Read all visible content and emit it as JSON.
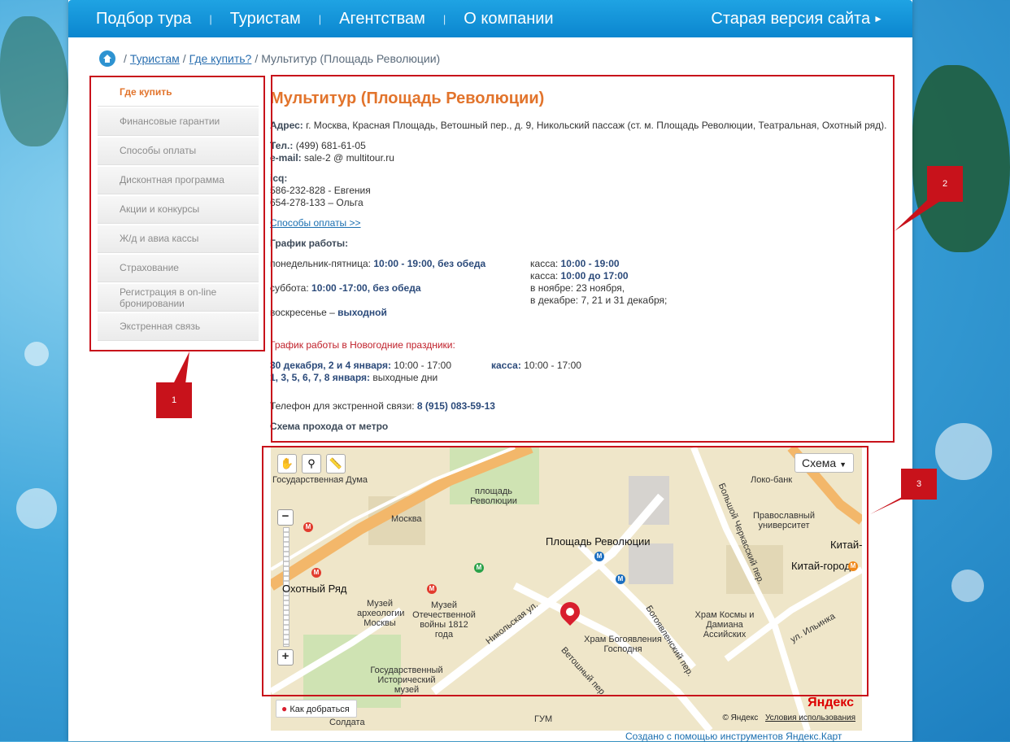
{
  "nav": {
    "items": [
      "Подбор тура",
      "Туристам",
      "Агентствам",
      "О компании"
    ],
    "old_site": "Старая версия сайта"
  },
  "breadcrumb": {
    "tourists": "Туристам",
    "where_buy": "Где купить?",
    "current": "Мультитур (Площадь Революции)"
  },
  "sidebar": {
    "items": [
      {
        "label": "Где купить"
      },
      {
        "label": "Финансовые гарантии"
      },
      {
        "label": "Способы оплаты"
      },
      {
        "label": "Дисконтная программа"
      },
      {
        "label": "Акции и конкурсы"
      },
      {
        "label": "Ж/д и авиа кассы"
      },
      {
        "label": "Страхование"
      },
      {
        "label": "Регистрация в on-line бронировании"
      },
      {
        "label": "Экстренная связь"
      }
    ]
  },
  "office": {
    "title": "Мультитур (Площадь Революции)",
    "address_label": "Адрес:",
    "address": "г. Москва, Красная Площадь, Ветошный пер., д. 9, Никольский пассаж (ст. м. Площадь Революции, Театральная, Охотный ряд).",
    "phone_label": "Тел.:",
    "phone": "(499) 681-61-05",
    "email_label": "e-mail:",
    "email": "sale-2 @ multitour.ru",
    "icq_label": "icq:",
    "icq_1": "586-232-828 - Евгения",
    "icq_2": "654-278-133 – Ольга",
    "payment_link": "Способы оплаты >>",
    "schedule_title": "График работы:",
    "weekday_label": "понедельник-пятница:",
    "weekday_hours": "10:00 - 19:00, без обеда",
    "saturday_label": "суббота:",
    "saturday_hours": "10:00 -17:00, без обеда",
    "sunday_label": "воскресенье –",
    "sunday_value": "выходной",
    "kassa_label_1": "касса:",
    "kassa_hours_1": "10:00 - 19:00",
    "kassa_label_2": "касса:",
    "kassa_hours_2": "10:00 до 17:00",
    "kassa_nov": "в ноябре: 23 ноября,",
    "kassa_dec": "в декабре: 7, 21 и 31 декабря;",
    "holiday_title": "График работы в Новогодние праздники:",
    "holiday_days_1": "30 декабря, 2 и 4 января:",
    "holiday_hours_1": "10:00 - 17:00",
    "holiday_kassa_label": "касса:",
    "holiday_kassa_hours": "10:00 - 17:00",
    "holiday_days_2": "1, 3, 5, 6, 7, 8 января:",
    "holiday_off": "выходные дни",
    "emergency_label": "Телефон для экстренной связи:",
    "emergency_phone": "8 (915) 083-59-13",
    "route_title": "Схема прохода от метро"
  },
  "map": {
    "scheme_button": "Схема",
    "how_to_get": "Как добраться",
    "yandex_logo": "Яндекс",
    "copyright": "© Яндекс",
    "terms": "Условия использования",
    "labels": {
      "duma": "Государственная Дума",
      "moskva": "Москва",
      "ploshchad_sverdlova": "площадь Революции",
      "ploshchad_rev": "Площадь Революции",
      "okhotny": "Охотный Ряд",
      "muzey_arkh": "Музей археологии Москвы",
      "muzey_1812": "Музей Отечественной войны 1812 года",
      "ist_muzey": "Государственный Исторический музей",
      "nikolskaya": "Никольская ул.",
      "vetoshny": "Ветошный пер.",
      "bogoyav": "Богоявленский пер.",
      "khram_bog": "Храм Богоявления Господня",
      "khram_kosmy": "Храм Космы и Дамиана Ассийских",
      "loko_bank": "Локо-банк",
      "pravoslav": "Православный университет",
      "kitay_gorod": "Китай-город",
      "kitay_g": "Китай-г",
      "ilyinka": "ул. Ильинка",
      "bolshoy_cherk": "Большой Черкасский пер.",
      "gum": "ГУМ",
      "soldata": "Солдата"
    }
  },
  "footer": {
    "created": "Создано с помощью инструментов Яндекс.Карт"
  },
  "annotations": [
    "1",
    "2",
    "3"
  ]
}
